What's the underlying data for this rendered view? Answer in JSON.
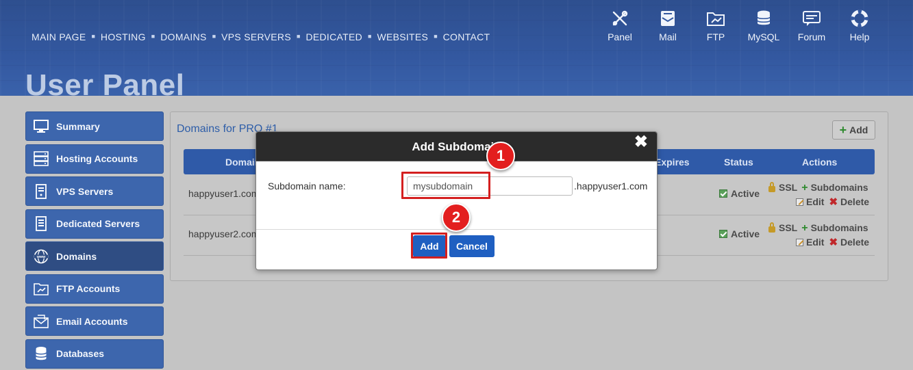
{
  "topnav": {
    "items": [
      "MAIN PAGE",
      "HOSTING",
      "DOMAINS",
      "VPS SERVERS",
      "DEDICATED",
      "WEBSITES",
      "CONTACT"
    ],
    "separator": "■"
  },
  "tools": [
    {
      "label": "Panel",
      "icon": "tools-icon"
    },
    {
      "label": "Mail",
      "icon": "mail-icon"
    },
    {
      "label": "FTP",
      "icon": "ftp-folder-icon"
    },
    {
      "label": "MySQL",
      "icon": "database-icon"
    },
    {
      "label": "Forum",
      "icon": "chat-icon"
    },
    {
      "label": "Help",
      "icon": "lifebuoy-icon"
    }
  ],
  "page_title": "User Panel",
  "sidebar": {
    "items": [
      {
        "label": "Summary",
        "icon": "monitor-icon"
      },
      {
        "label": "Hosting Accounts",
        "icon": "server-icon"
      },
      {
        "label": "VPS Servers",
        "icon": "vps-icon"
      },
      {
        "label": "Dedicated Servers",
        "icon": "dedicated-server-icon"
      },
      {
        "label": "Domains",
        "icon": "www-globe-icon",
        "active": true
      },
      {
        "label": "FTP Accounts",
        "icon": "ftp-folder-icon"
      },
      {
        "label": "Email Accounts",
        "icon": "email-icon"
      },
      {
        "label": "Databases",
        "icon": "database-icon"
      }
    ]
  },
  "panel": {
    "title": "Domains for PRO #1",
    "add_label": "Add",
    "columns": {
      "domain": "Domain",
      "expires": "Expires",
      "status": "Status",
      "actions": "Actions"
    },
    "rows": [
      {
        "domain": "happyuser1.com",
        "status": "Active"
      },
      {
        "domain": "happyuser2.com",
        "status": "Active"
      }
    ],
    "actions": {
      "ssl": "SSL",
      "subdomains": "Subdomains",
      "edit": "Edit",
      "delete": "Delete"
    }
  },
  "modal": {
    "title": "Add Subdomain",
    "close": "✖",
    "field_label": "Subdomain name:",
    "field_value": "mysubdomain",
    "suffix": ".happyuser1.com",
    "add_label": "Add",
    "cancel_label": "Cancel"
  },
  "annotations": {
    "step1": "1",
    "step2": "2"
  },
  "colors": {
    "brand": "#3358a0",
    "button": "#1f5fc1",
    "highlight": "#d41f1f"
  }
}
